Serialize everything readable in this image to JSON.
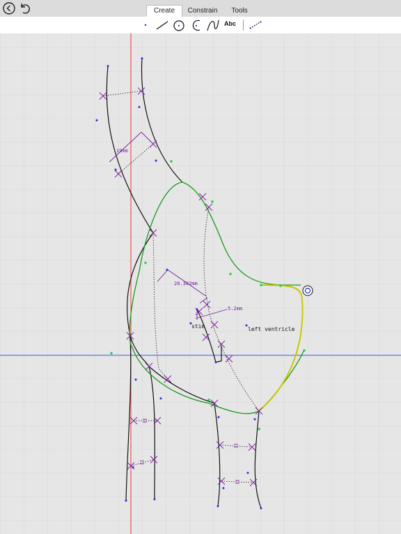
{
  "header": {
    "tabs": [
      {
        "label": "Create",
        "active": true
      },
      {
        "label": "Constrain",
        "active": false
      },
      {
        "label": "Tools",
        "active": false
      }
    ],
    "back_icon": "chevron-left-circle-icon",
    "undo_icon": "undo-arrow-icon"
  },
  "toolbar": {
    "tools": [
      "point-tool-icon",
      "line-tool-icon",
      "circle-tool-icon",
      "arc-tool-icon",
      "spline-tool-icon",
      "text-tool-icon",
      "construction-line-tool-icon"
    ],
    "text_tool_label": "Abc"
  },
  "sketch": {
    "dimensions": {
      "d1": "19mm",
      "d2": "20.302mm",
      "d3": "5.2mm"
    },
    "labels": {
      "stim": "stim",
      "lv": "left ventricle"
    },
    "colors": {
      "grid": "#c9c9c9",
      "red_axis": "#e53935",
      "blue_axis": "#3d5afe",
      "curve": "#111111",
      "green_curve": "#1a9a1a",
      "selected_curve": "#c8c800",
      "constraint": "#7a1fa0",
      "point": "#2a2ad0",
      "green_point": "#22cc55"
    }
  }
}
